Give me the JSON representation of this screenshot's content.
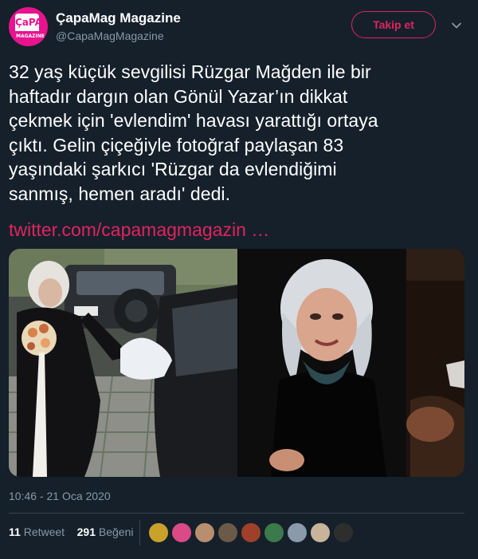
{
  "account": {
    "name": "ÇapaMag Magazine",
    "handle": "@CapaMagMagazine",
    "avatar_logo_top": "ÇaPA",
    "avatar_logo_bottom": "MAGAZINE",
    "avatar_color": "#e8138e"
  },
  "follow_button": {
    "label": "Takip et",
    "color": "#e0245e"
  },
  "menu_icon": "chevron-down-icon",
  "tweet": {
    "lines": [
      "32 yaş küçük sevgilisi Rüzgar Mağden ile bir",
      "haftadır dargın olan Gönül Yazar’ın dikkat",
      "çekmek için 'evlendim' havası yarattığı ortaya",
      "çıktı. Gelin çiçeğiyle fotoğraf paylaşan 83",
      "yaşındaki şarkıcı 'Rüzgar da evlendiğimi",
      "sanmış, hemen aradı' dedi."
    ],
    "link": "twitter.com/capamagmagazin …",
    "link_color": "#e0245e"
  },
  "timestamp": "10:46 - 21 Oca 2020",
  "stats": {
    "retweet_count": "11",
    "retweet_label": "Retweet",
    "like_count": "291",
    "like_label": "Beğeni"
  },
  "likers": [
    {
      "color": "#c9a22c"
    },
    {
      "color": "#d94a86"
    },
    {
      "color": "#b88f6e"
    },
    {
      "color": "#6b5a48"
    },
    {
      "color": "#a0402a"
    },
    {
      "color": "#3b7a4a"
    },
    {
      "color": "#8a9aab"
    },
    {
      "color": "#c8b49a"
    },
    {
      "color": "#2e2e2e"
    }
  ],
  "theme": {
    "background": "#15202b",
    "muted": "#8899a6",
    "border": "#38444d"
  }
}
